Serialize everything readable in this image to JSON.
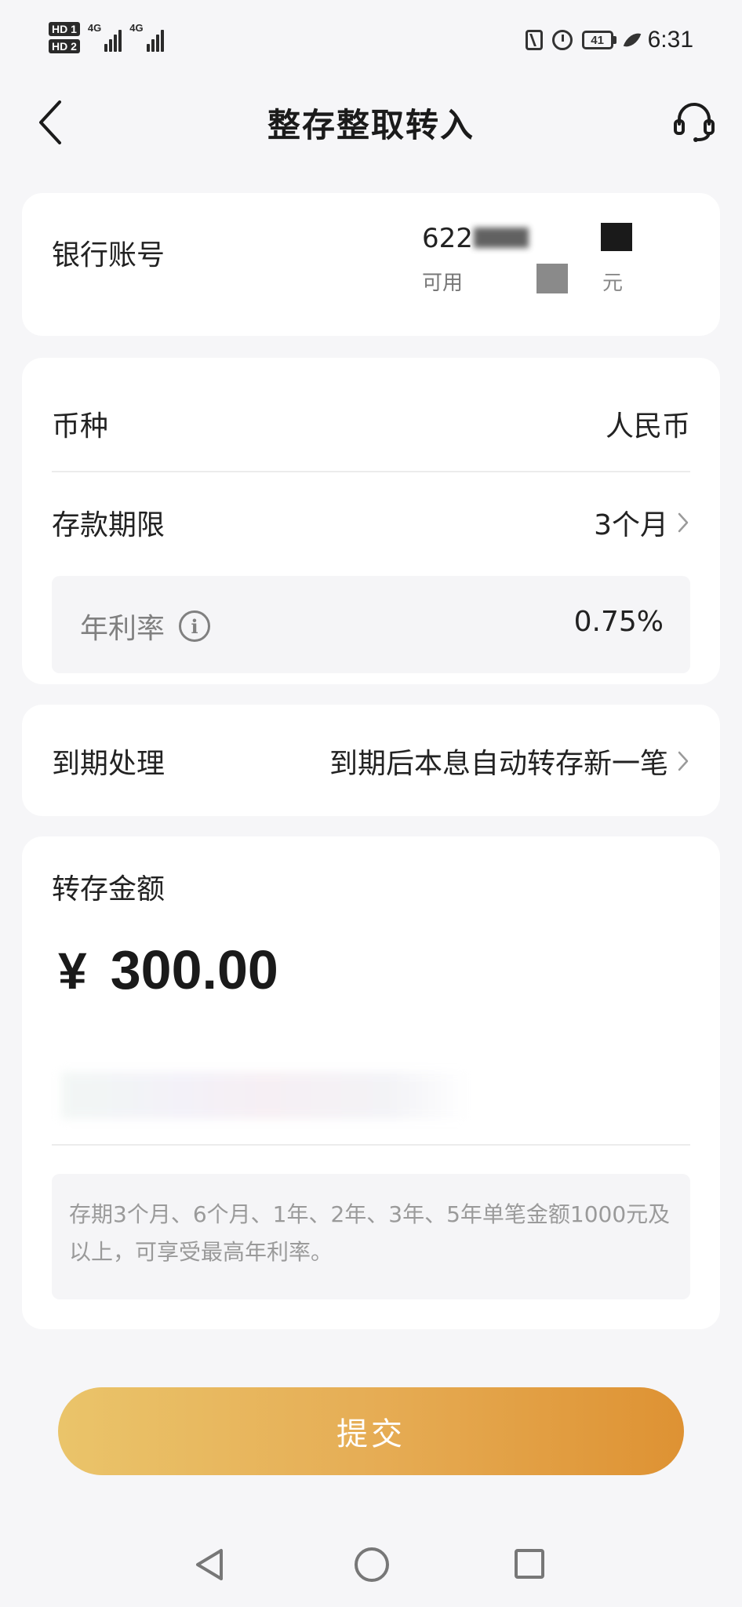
{
  "status_bar": {
    "sim1": "HD 1",
    "sim2": "HD 2",
    "net1": "4G",
    "net2": "4G",
    "battery": "41",
    "time": "6:31"
  },
  "header": {
    "title": "整存整取转入"
  },
  "account": {
    "label": "银行账号",
    "number_prefix": "622",
    "available_prefix": "可用",
    "available_suffix": "元"
  },
  "deposit": {
    "currency_label": "币种",
    "currency_value": "人民币",
    "term_label": "存款期限",
    "term_value": "3个月",
    "rate_label": "年利率",
    "rate_value": "0.75%"
  },
  "maturity": {
    "label": "到期处理",
    "value": "到期后本息自动转存新一笔"
  },
  "amount": {
    "label": "转存金额",
    "currency_symbol": "¥",
    "value": "300.00",
    "note": "存期3个月、6个月、1年、2年、3年、5年单笔金额1000元及以上，可享受最高年利率。"
  },
  "submit_label": "提交"
}
